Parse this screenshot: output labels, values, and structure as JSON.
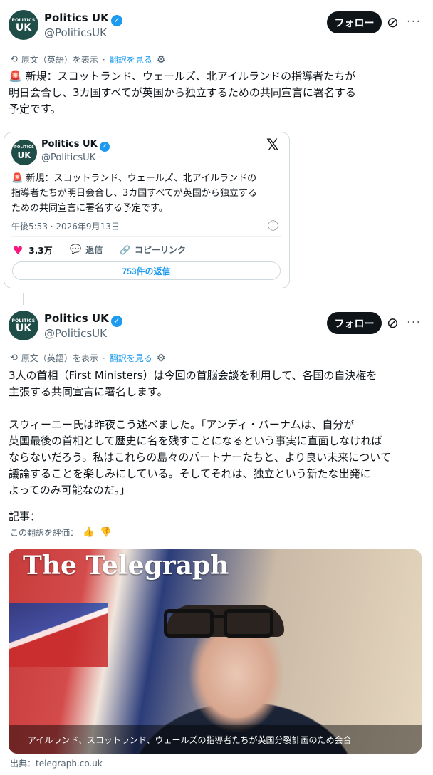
{
  "tweet1": {
    "author_name": "Politics UK",
    "handle": "@PoliticsUK",
    "avatar_line1": "POLITICS",
    "avatar_line2": "UK",
    "follow_label": "フォロー",
    "show_original": "原文（英語）を表示",
    "see_translation": "翻訳を見る",
    "siren": "🚨",
    "lines": [
      "新規：スコットランド、ウェールズ、北アイルランドの指導者たちが",
      "明日会合し、3カ国すべてが英国から独立するための共同宣言に署名する",
      "予定です。"
    ]
  },
  "quote": {
    "author_name": "Politics UK",
    "handle": "@PoliticsUK ·",
    "x_logo": "𝕏",
    "lines": [
      "新規：スコットランド、ウェールズ、北アイルランドの",
      "指導者たちが明日会合し、3カ国すべてが英国から独立する",
      "ための共同宣言に署名する予定です。"
    ],
    "timestamp": "午後5:53 · 2026年9月13日",
    "likes": "3.3万",
    "reply_label": "返信",
    "copy_link_label": "コピーリンク",
    "replies_button": "753件の返信"
  },
  "tweet2": {
    "author_name": "Politics UK",
    "handle": "@PoliticsUK",
    "avatar_line1": "POLITICS",
    "avatar_line2": "UK",
    "follow_label": "フォロー",
    "show_original": "原文（英語）を表示",
    "see_translation": "翻訳を見る",
    "para1": [
      "3人の首相（First Ministers）は今回の首脳会談を利用して、各国の自決権を",
      "主張する共同宣言に署名します。"
    ],
    "para2": [
      "スウィーニー氏は昨夜こう述べました。「アンディ・バーナムは、自分が",
      "英国最後の首相として歴史に名を残すことになるという事実に直面しなければ",
      "ならないだろう。私はこれらの島々のパートナーたちと、より良い未来について",
      "議論することを楽しみにしている。そしてそれは、独立という新たな出発に",
      "よってのみ可能なのだ。」"
    ],
    "article_label": "記事：",
    "rate_translation": "この翻訳を評価：",
    "image_logo": "The Telegraph",
    "image_caption": "アイルランド、スコットランド、ウェールズの指導者たちが英国分裂計画のため会合",
    "source": "出典：telegraph.co.uk"
  },
  "icons": {
    "verified": "✓",
    "translate": "⟲",
    "gear": "⚙",
    "grok": "⊘",
    "more": "···",
    "heart": "♥",
    "reply": "💬",
    "link": "🔗",
    "info": "ⓘ",
    "thumbs_up": "👍",
    "thumbs_down": "👎"
  },
  "colors": {
    "accent": "#1d9bf0",
    "like": "#f91880",
    "text": "#0f1419",
    "muted": "#536471"
  }
}
